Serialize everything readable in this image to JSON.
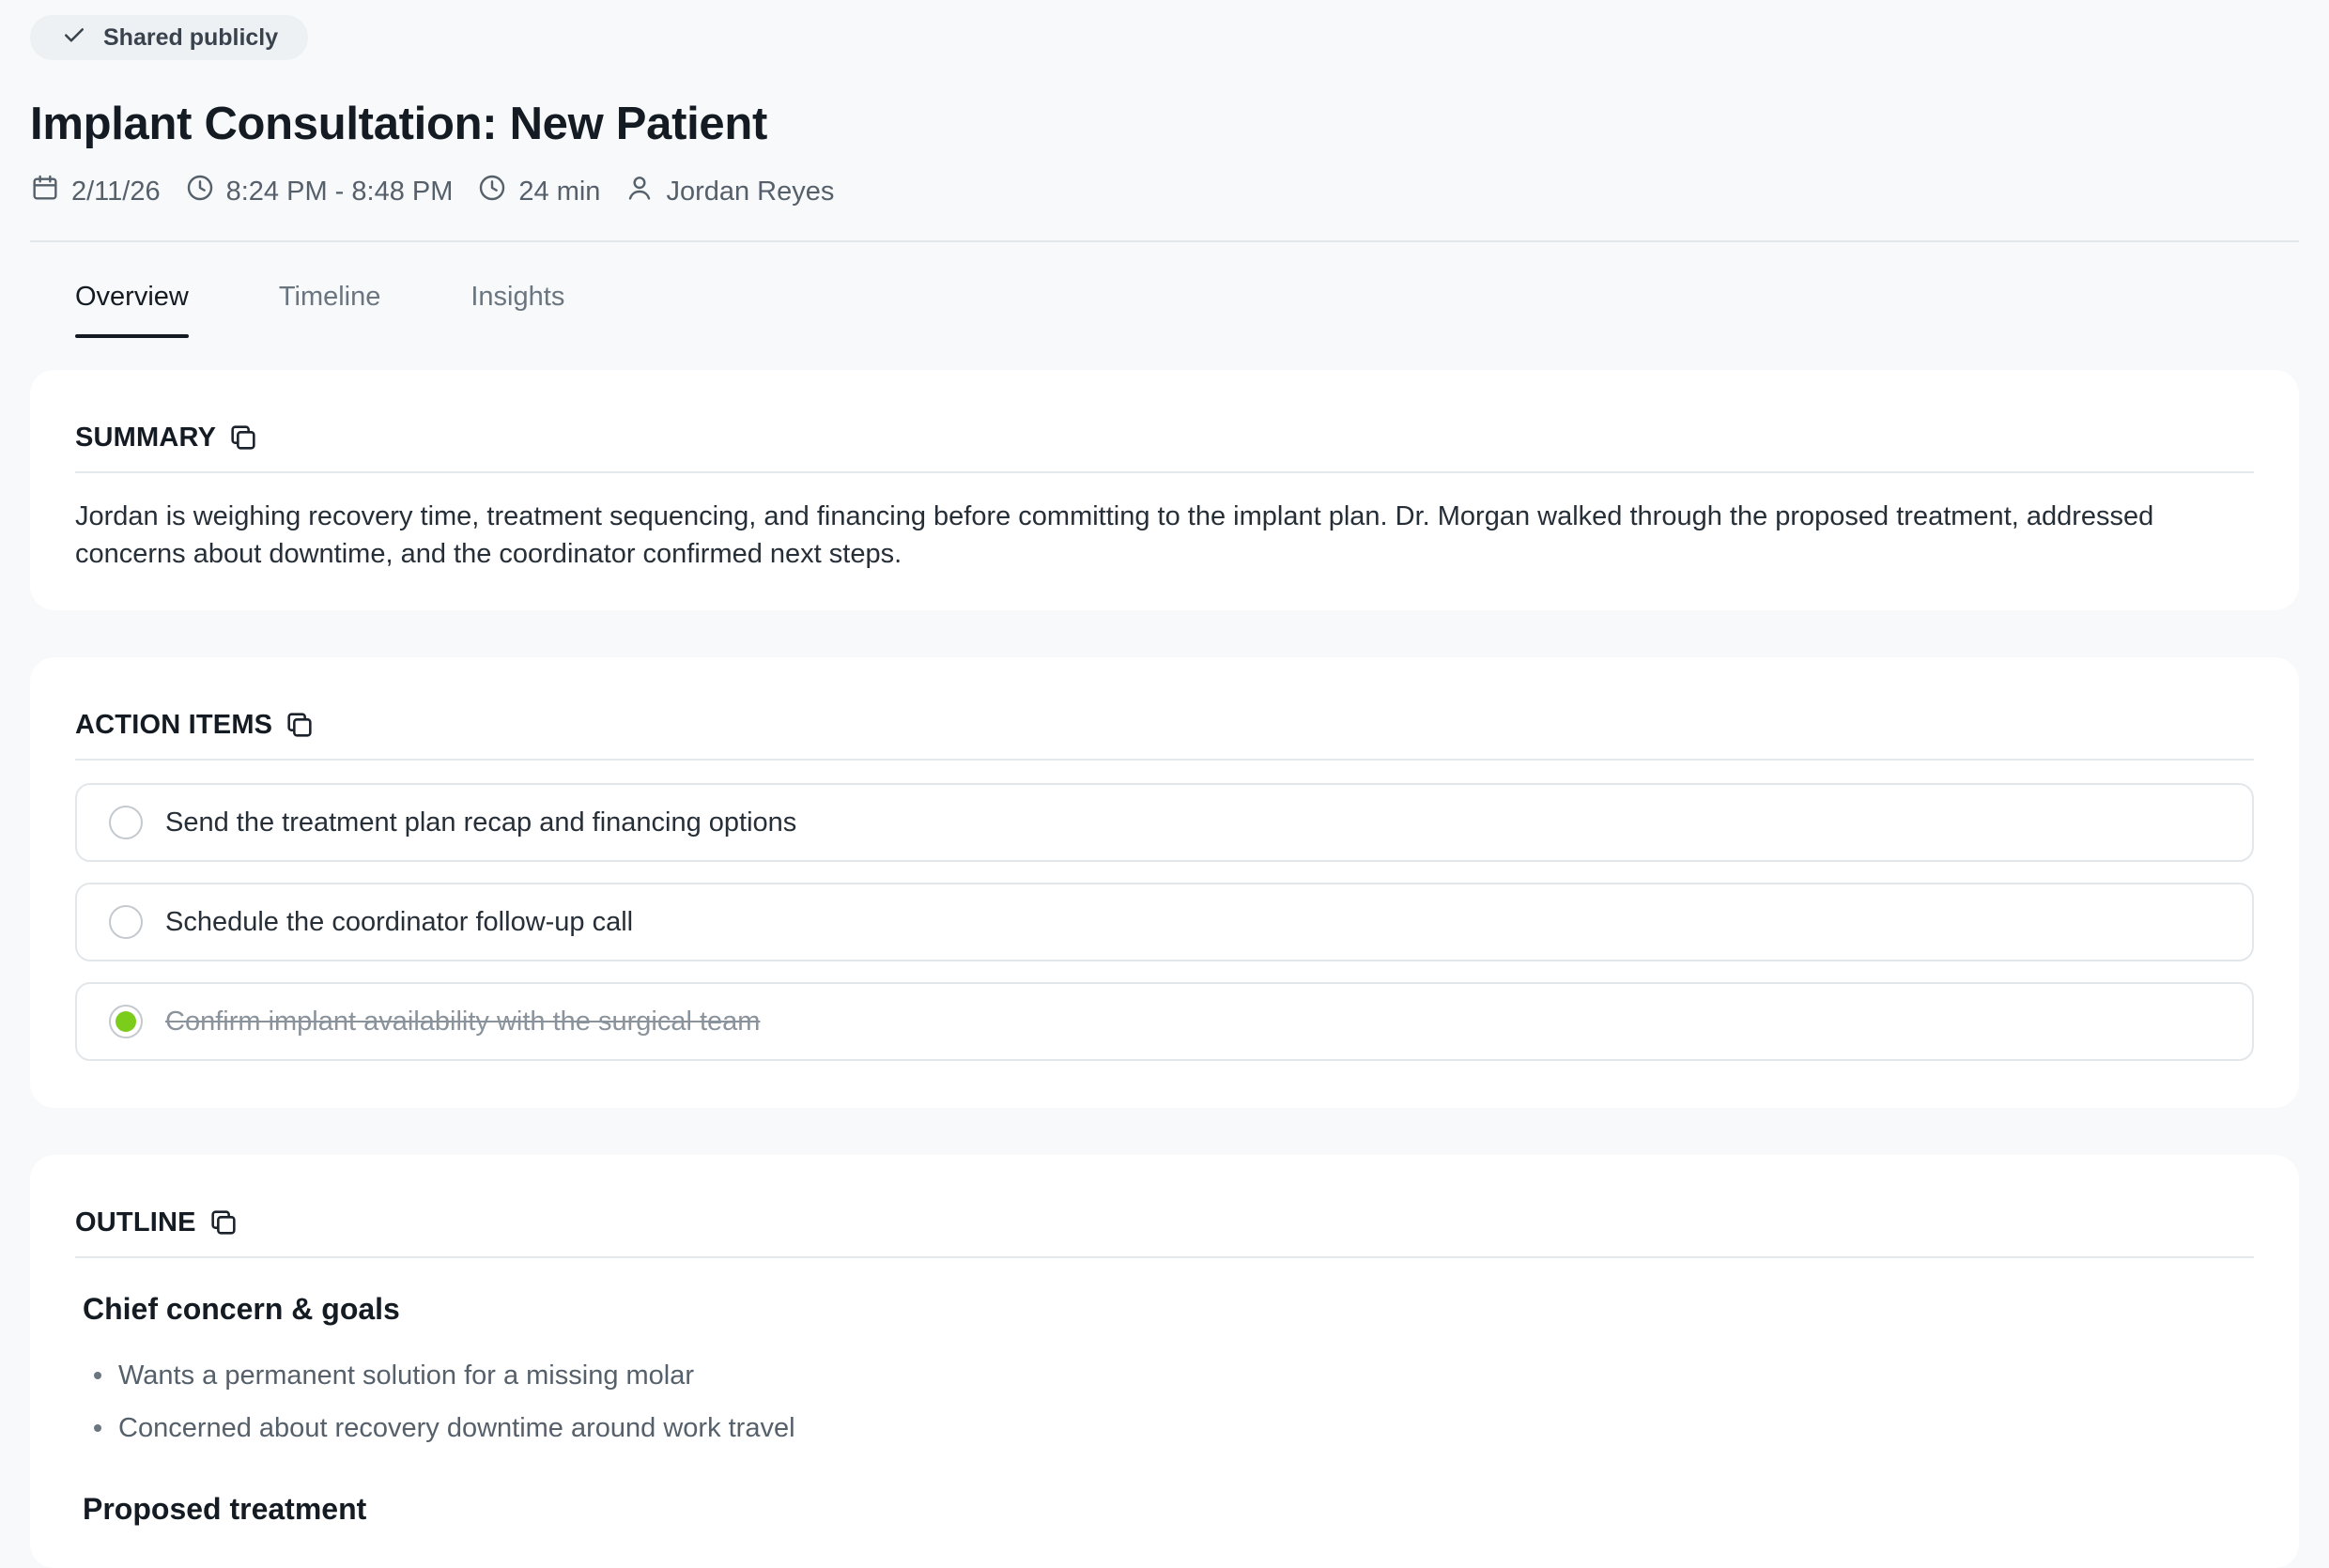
{
  "share": {
    "label": "Shared publicly"
  },
  "meeting": {
    "title": "Implant Consultation: New Patient",
    "date": "2/11/26",
    "time_range": "8:24 PM - 8:48 PM",
    "duration": "24 min",
    "participant": "Jordan Reyes"
  },
  "tabs": [
    {
      "label": "Overview",
      "active": true
    },
    {
      "label": "Timeline",
      "active": false
    },
    {
      "label": "Insights",
      "active": false
    }
  ],
  "summary": {
    "heading": "SUMMARY",
    "text": "Jordan is weighing recovery time, treatment sequencing, and financing before committing to the implant plan. Dr. Morgan walked through the proposed treatment, addressed concerns about downtime, and the coordinator confirmed next steps."
  },
  "action_items": {
    "heading": "ACTION ITEMS",
    "items": [
      {
        "label": "Send the treatment plan recap and financing options",
        "done": false
      },
      {
        "label": "Schedule the coordinator follow-up call",
        "done": false
      },
      {
        "label": "Confirm implant availability with the surgical team",
        "done": true
      }
    ]
  },
  "outline": {
    "heading": "OUTLINE",
    "sections": [
      {
        "title": "Chief concern & goals",
        "bullets": [
          "Wants a permanent solution for a missing molar",
          "Concerned about recovery downtime around work travel"
        ]
      },
      {
        "title": "Proposed treatment",
        "bullets": []
      }
    ]
  },
  "icons": {
    "share": "check-icon",
    "date": "calendar-icon",
    "time": "clock-icon",
    "duration": "clock-icon",
    "participant": "user-icon",
    "copy": "copy-icon"
  },
  "colors": {
    "background": "#f7f9fa",
    "card": "#ffffff",
    "done_indicator": "#7ccc1c",
    "text_primary": "#141b23",
    "text_muted": "#56606b"
  }
}
